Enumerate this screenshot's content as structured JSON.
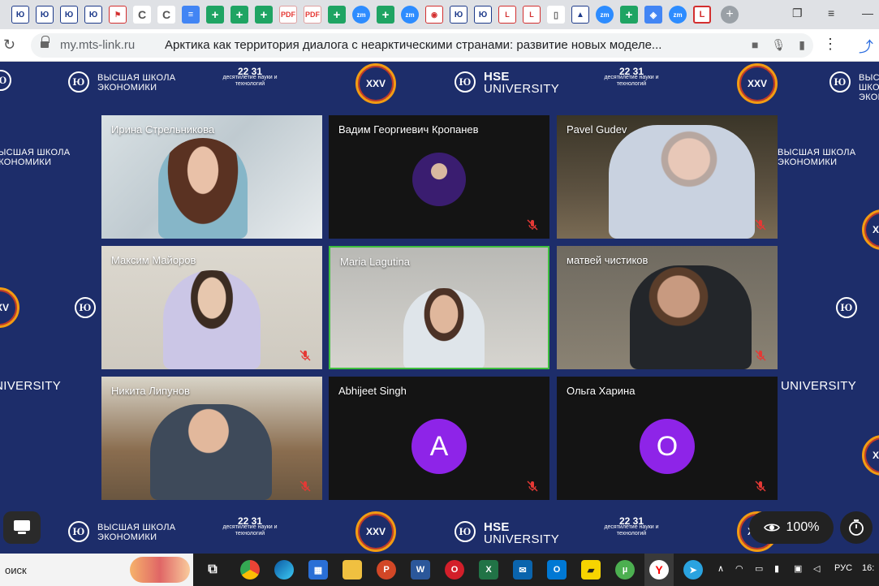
{
  "browser": {
    "domain": "my.mts-link.ru",
    "page_title": "Арктика как территория диалога с неарктическими странами: развитие новых моделе...",
    "tabs": [
      {
        "icon": "hse-icon",
        "glyph": "Ю"
      },
      {
        "icon": "hse-icon",
        "glyph": "Ю"
      },
      {
        "icon": "hse-icon",
        "glyph": "Ю"
      },
      {
        "icon": "hse-icon",
        "glyph": "Ю"
      },
      {
        "icon": "flag-icon",
        "glyph": "⚑"
      },
      {
        "icon": "c-icon",
        "glyph": "C"
      },
      {
        "icon": "c-icon",
        "glyph": "C"
      },
      {
        "icon": "google-docs-icon",
        "glyph": "≡"
      },
      {
        "icon": "google-plus-icon",
        "glyph": "+"
      },
      {
        "icon": "google-plus-icon",
        "glyph": "+"
      },
      {
        "icon": "google-plus-icon",
        "glyph": "+"
      },
      {
        "icon": "pdf-icon",
        "glyph": "PDF"
      },
      {
        "icon": "pdf-icon",
        "glyph": "PDF"
      },
      {
        "icon": "google-plus-icon",
        "glyph": "+"
      },
      {
        "icon": "zoom-icon",
        "glyph": "zm"
      },
      {
        "icon": "google-plus-icon",
        "glyph": "+"
      },
      {
        "icon": "zoom-icon",
        "glyph": "zm"
      },
      {
        "icon": "lips-icon",
        "glyph": "◉"
      },
      {
        "icon": "hse-icon",
        "glyph": "Ю"
      },
      {
        "icon": "hse-icon",
        "glyph": "Ю"
      },
      {
        "icon": "mts-link-icon",
        "glyph": "L"
      },
      {
        "icon": "mts-link-icon",
        "glyph": "L"
      },
      {
        "icon": "document-icon",
        "glyph": "▯"
      },
      {
        "icon": "car-icon",
        "glyph": "▲"
      },
      {
        "icon": "zoom-icon",
        "glyph": "zm"
      },
      {
        "icon": "google-plus-icon",
        "glyph": "+"
      },
      {
        "icon": "shield-icon",
        "glyph": "◈"
      },
      {
        "icon": "zoom-icon",
        "glyph": "zm"
      },
      {
        "icon": "mts-link-icon",
        "glyph": "L"
      }
    ]
  },
  "background": {
    "hse_ru_line1": "ВЫСШАЯ ШКОЛА",
    "hse_ru_line2": "ЭКОНОМИКИ",
    "hse_en_line1": "HSE",
    "hse_en_line2": "UNIVERSITY",
    "xxv": "XXV",
    "decade_num": "22 31",
    "decade_text": "десятилетие науки и технологий"
  },
  "participants": [
    {
      "name": "Ирина Стрельникова",
      "type": "video",
      "muted": false
    },
    {
      "name": "Вадим Георгиевич Кропанев",
      "type": "photo",
      "muted": true
    },
    {
      "name": "Pavel Gudev",
      "type": "video",
      "muted": true
    },
    {
      "name": "Максим Майоров",
      "type": "video",
      "muted": true
    },
    {
      "name": "Maria Lagutina",
      "type": "video",
      "muted": false,
      "speaking": true
    },
    {
      "name": "матвей чистиков",
      "type": "video",
      "muted": true
    },
    {
      "name": "Никита Липунов",
      "type": "video",
      "muted": true
    },
    {
      "name": "Abhijeet Singh",
      "type": "letter",
      "letter": "A",
      "muted": true
    },
    {
      "name": "Ольга Харина",
      "type": "letter",
      "letter": "O",
      "muted": true
    }
  ],
  "overlays": {
    "zoom_level": "100%"
  },
  "taskbar": {
    "search_text": "оиск",
    "language": "РУС",
    "clock": "16:"
  },
  "colors": {
    "stage_bg": "#1d2d6a",
    "avatar_purple": "#8e24e8",
    "active_speaker_border": "#3fbf3f",
    "mute_red": "#e53935"
  }
}
